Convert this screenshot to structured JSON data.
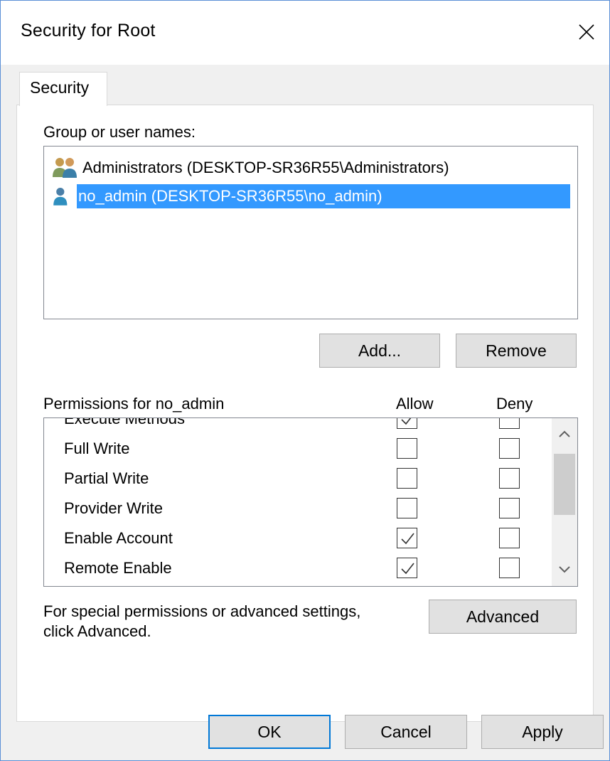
{
  "window": {
    "title": "Security for Root"
  },
  "tabs": [
    {
      "label": "Security",
      "active": true
    }
  ],
  "names_section": {
    "label": "Group or user names:",
    "items": [
      {
        "label": "Administrators (DESKTOP-SR36R55\\Administrators)",
        "icon": "users-group-icon",
        "selected": false
      },
      {
        "label": "no_admin (DESKTOP-SR36R55\\no_admin)",
        "icon": "user-icon",
        "selected": true
      }
    ],
    "add_label": "Add...",
    "remove_label": "Remove"
  },
  "permissions": {
    "label": "Permissions for no_admin",
    "allow_header": "Allow",
    "deny_header": "Deny",
    "rows": [
      {
        "name": "Execute Methods",
        "allow": true,
        "deny": false
      },
      {
        "name": "Full Write",
        "allow": false,
        "deny": false
      },
      {
        "name": "Partial Write",
        "allow": false,
        "deny": false
      },
      {
        "name": "Provider Write",
        "allow": false,
        "deny": false
      },
      {
        "name": "Enable Account",
        "allow": true,
        "deny": false
      },
      {
        "name": "Remote Enable",
        "allow": true,
        "deny": false
      }
    ]
  },
  "advanced": {
    "note_line1": "For special permissions or advanced settings,",
    "note_line2": "click Advanced.",
    "button_label": "Advanced"
  },
  "footer": {
    "ok_label": "OK",
    "cancel_label": "Cancel",
    "apply_label": "Apply"
  },
  "colors": {
    "selection": "#3399ff",
    "accent": "#0078d7",
    "frame": "#5b8fd6"
  }
}
